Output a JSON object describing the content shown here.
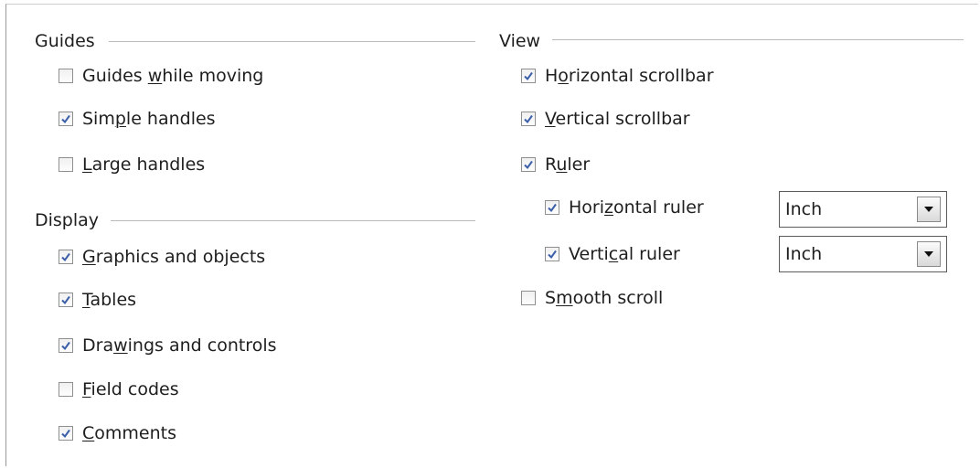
{
  "guides": {
    "title": "Guides",
    "items": [
      {
        "pre": "Guides ",
        "u": "w",
        "post": "hile moving",
        "checked": false
      },
      {
        "pre": "Sim",
        "u": "p",
        "post": "le handles",
        "checked": true
      },
      {
        "pre": "",
        "u": "L",
        "post": "arge handles",
        "checked": false
      }
    ]
  },
  "display": {
    "title": "Display",
    "items": [
      {
        "pre": "",
        "u": "G",
        "post": "raphics and objects",
        "checked": true
      },
      {
        "pre": "",
        "u": "T",
        "post": "ables",
        "checked": true
      },
      {
        "pre": "Dra",
        "u": "w",
        "post": "ings and controls",
        "checked": true
      },
      {
        "pre": "",
        "u": "F",
        "post": "ield codes",
        "checked": false
      },
      {
        "pre": "",
        "u": "C",
        "post": "omments",
        "checked": true
      }
    ]
  },
  "view": {
    "title": "View",
    "items": [
      {
        "pre": "H",
        "u": "o",
        "post": "rizontal scrollbar",
        "checked": true
      },
      {
        "pre": "",
        "u": "V",
        "post": "ertical scrollbar",
        "checked": true
      },
      {
        "pre": "R",
        "u": "u",
        "post": "ler",
        "checked": true
      },
      {
        "pre": "Hori",
        "u": "z",
        "post": "ontal ruler",
        "checked": true
      },
      {
        "pre": "Verti",
        "u": "c",
        "post": "al ruler",
        "checked": true
      },
      {
        "pre": "S",
        "u": "m",
        "post": "ooth scroll",
        "checked": false
      }
    ],
    "horizontal_ruler_unit": "Inch",
    "vertical_ruler_unit": "Inch"
  }
}
